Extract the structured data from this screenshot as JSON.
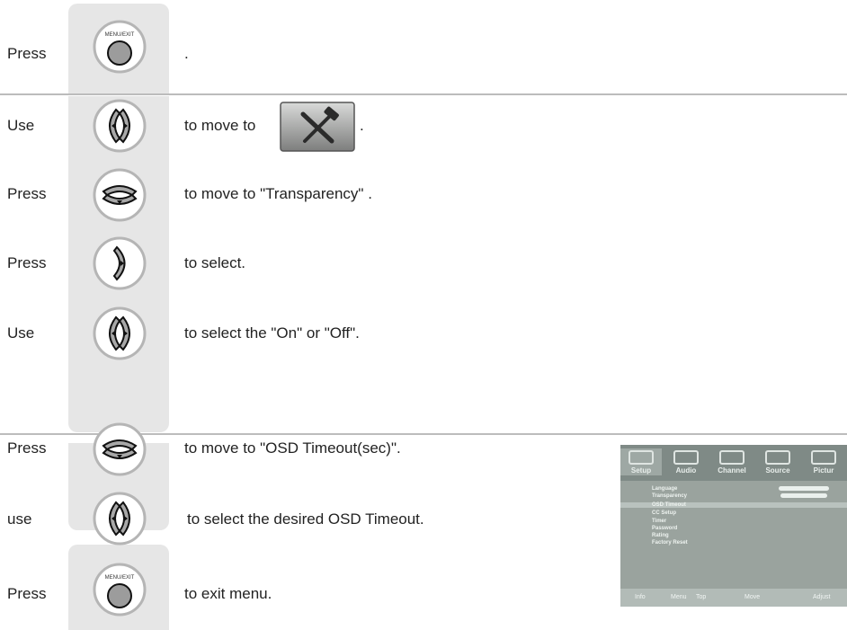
{
  "steps": [
    {
      "label": "Press",
      "description": ".",
      "button": "menu-exit"
    },
    {
      "label": "Use",
      "description": "to move to",
      "button": "left-right",
      "trailing": "."
    },
    {
      "label": "Press",
      "description": "to move to \"Transparency\" .",
      "button": "down"
    },
    {
      "label": "Press",
      "description": "to select.",
      "button": "right"
    },
    {
      "label": "Use",
      "description": "to select the \"On\" or \"Off\".",
      "button": "left-right"
    },
    {
      "label": "Press",
      "description": "to move to \"OSD Timeout(sec)\".",
      "button": "down"
    },
    {
      "label": "use",
      "description": "to select the desired OSD Timeout.",
      "button": "left-right"
    },
    {
      "label": "Press",
      "description": "to exit menu.",
      "button": "menu-exit"
    }
  ],
  "button_caption": "MENU/EXIT",
  "setup_icon": "setup-tools-icon",
  "osd": {
    "tabs": [
      "Setup",
      "Audio",
      "Channel",
      "Source",
      "Pictur"
    ],
    "items": [
      "Language",
      "Transparency",
      "OSD Timeout",
      "CC Setup",
      "Timer",
      "Password",
      "Rating",
      "Factory Reset"
    ],
    "footer": {
      "info": "Info",
      "menu": "Menu",
      "menu_action": "Top",
      "move": "Move",
      "adjust": "Adjust"
    }
  }
}
